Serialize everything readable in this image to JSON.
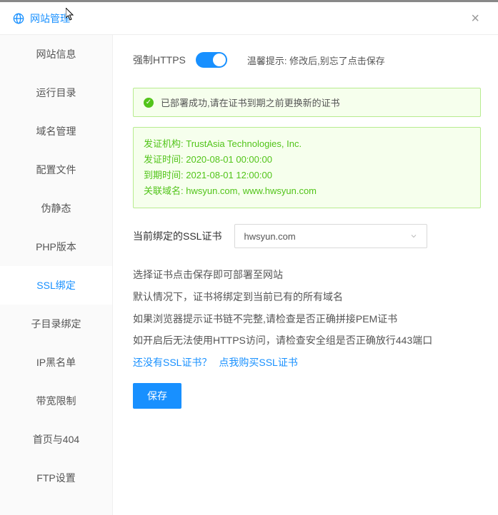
{
  "title": "网站管理",
  "sidebar": {
    "items": [
      {
        "label": "网站信息"
      },
      {
        "label": "运行目录"
      },
      {
        "label": "域名管理"
      },
      {
        "label": "配置文件"
      },
      {
        "label": "伪静态"
      },
      {
        "label": "PHP版本"
      },
      {
        "label": "SSL绑定"
      },
      {
        "label": "子目录绑定"
      },
      {
        "label": "IP黑名单"
      },
      {
        "label": "带宽限制"
      },
      {
        "label": "首页与404"
      },
      {
        "label": "FTP设置"
      }
    ],
    "active_index": 6
  },
  "https_row": {
    "label": "强制HTTPS",
    "on": true,
    "tip_prefix": "温馨提示:",
    "tip_text": "修改后,别忘了点击保存"
  },
  "deploy_alert": "已部署成功,请在证书到期之前更换新的证书",
  "cert": {
    "issuer_label": "发证机构: ",
    "issuer": "TrustAsia Technologies, Inc.",
    "issued_label": "发证时间: ",
    "issued": "2020-08-01 00:00:00",
    "expire_label": "到期时间: ",
    "expire": "2021-08-01 12:00:00",
    "domains_label": "关联域名: ",
    "domains": "hwsyun.com, www.hwsyun.com"
  },
  "select_row": {
    "label": "当前绑定的SSL证书",
    "value": "hwsyun.com"
  },
  "help_lines": [
    "选择证书点击保存即可部署至网站",
    "默认情况下，证书将绑定到当前已有的所有域名",
    "如果浏览器提示证书链不完整,请检查是否正确拼接PEM证书",
    "如开启后无法使用HTTPS访问，请检查安全组是否正确放行443端口"
  ],
  "link_line": {
    "q": "还没有SSL证书？",
    "a": "点我购买SSL证书"
  },
  "save_label": "保存"
}
